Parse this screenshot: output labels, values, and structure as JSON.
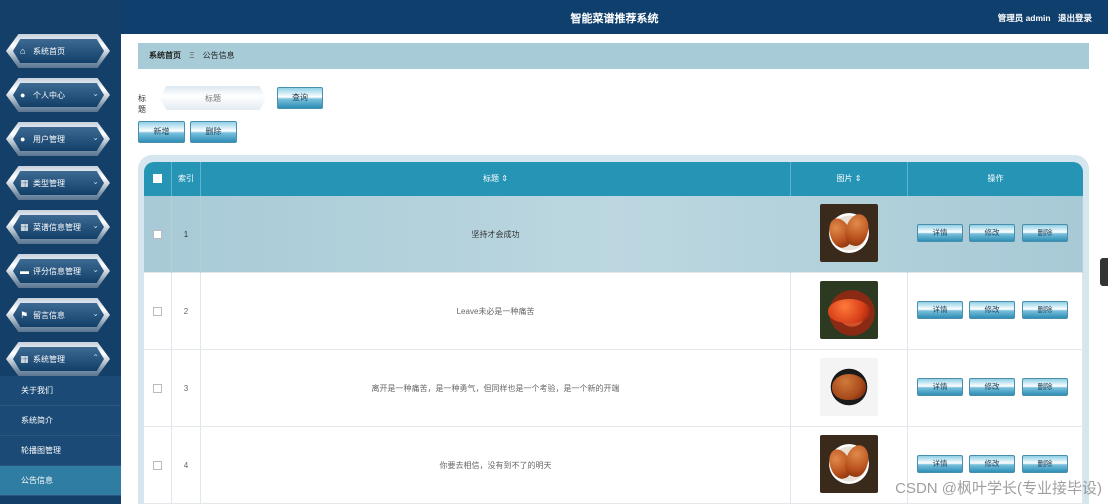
{
  "header": {
    "title": "智能菜谱推荐系统",
    "user_label": "管理员 admin",
    "logout_label": "退出登录"
  },
  "sidebar": {
    "items": [
      {
        "label": "系统首页",
        "icon": "home-icon",
        "glyph": "⌂",
        "has_chevron": false
      },
      {
        "label": "个人中心",
        "icon": "user-icon",
        "glyph": "●",
        "has_chevron": true
      },
      {
        "label": "用户管理",
        "icon": "user-icon",
        "glyph": "●",
        "has_chevron": true
      },
      {
        "label": "类型管理",
        "icon": "grid-icon",
        "glyph": "▦",
        "has_chevron": true
      },
      {
        "label": "菜谱信息管理",
        "icon": "grid-icon",
        "glyph": "▦",
        "has_chevron": true
      },
      {
        "label": "评分信息管理",
        "icon": "comment-icon",
        "glyph": "▬",
        "has_chevron": true
      },
      {
        "label": "留言信息",
        "icon": "flag-icon",
        "glyph": "⚑",
        "has_chevron": true
      },
      {
        "label": "系统管理",
        "icon": "grid-icon",
        "glyph": "▦",
        "has_chevron": true,
        "expanded": true
      }
    ],
    "subitems": [
      {
        "label": "关于我们",
        "active": false
      },
      {
        "label": "系统简介",
        "active": false
      },
      {
        "label": "轮播图管理",
        "active": false
      },
      {
        "label": "公告信息",
        "active": true
      }
    ]
  },
  "breadcrumb": {
    "home": "系统首页",
    "separator": "Ξ",
    "current": "公告信息"
  },
  "search": {
    "label": "标题",
    "placeholder": "标题",
    "query_button": "查询"
  },
  "actions": {
    "add_button": "新增",
    "delete_button": "删除"
  },
  "table": {
    "columns": [
      "",
      "索引",
      "标题 ⇕",
      "图片 ⇕",
      "操作"
    ],
    "rows": [
      {
        "index": "1",
        "title": "坚持才会成功",
        "image": "food-image-braised-drumsticks"
      },
      {
        "index": "2",
        "title": "Leave未必是一种痛苦",
        "image": "food-image-spicy-crab"
      },
      {
        "index": "3",
        "title": "离开是一种痛苦，是一种勇气，但同样也是一个考验，是一个新的开端",
        "image": "food-image-stir-fry"
      },
      {
        "index": "4",
        "title": "你要去相信，没有到不了的明天",
        "image": "food-image-braised-drumsticks"
      }
    ],
    "row_actions": {
      "detail": "详情",
      "edit": "修改",
      "delete": "删除"
    }
  },
  "watermark": "CSDN @枫叶学长(专业接毕设)",
  "colors": {
    "header_bg": "#0f3f6c",
    "sidebar_bg": "#133f68",
    "table_header": "#2594b5",
    "breadcrumb_bg": "#a8ccd7",
    "active_sub": "#2f7da3"
  }
}
